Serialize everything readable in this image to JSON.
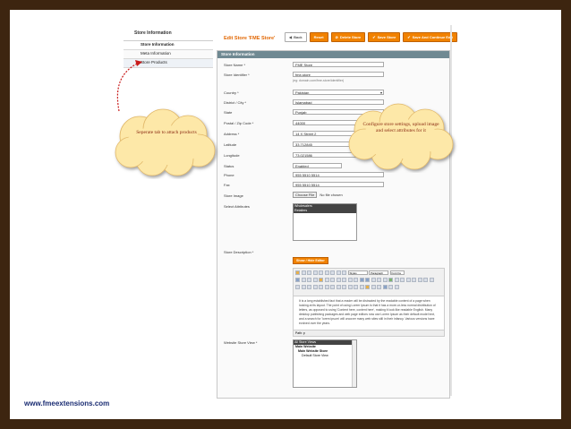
{
  "footer": {
    "url": "www.fmeextensions.com"
  },
  "sidebar": {
    "header": "Store Information",
    "items": [
      {
        "label": "Store Information"
      },
      {
        "label": "Meta Information"
      },
      {
        "label": "Store Products"
      }
    ]
  },
  "header": {
    "title": "Edit Store 'FME Store'",
    "buttons": {
      "back": "Back",
      "reset": "Reset",
      "delete": "Delete Store",
      "save": "Save Store",
      "save_continue": "Save And Continue Edit"
    }
  },
  "panel": {
    "title": "Store Information",
    "fields": {
      "store_name": {
        "label": "Store Name *",
        "value": "FME Store"
      },
      "store_identifier": {
        "label": "Store Identifier *",
        "value": "fme-store",
        "hint": "(eg: domain.com/fme-store/identifier)"
      },
      "country": {
        "label": "Country *",
        "value": "Pakistan"
      },
      "district_city": {
        "label": "District / City *",
        "value": "Islamabad"
      },
      "state": {
        "label": "State",
        "value": "Punjab"
      },
      "postal_zip": {
        "label": "Postal / Zip Code *",
        "value": "44000"
      },
      "address": {
        "label": "Address *",
        "value": "14 X Street 2"
      },
      "latitude": {
        "label": "Latitude",
        "value": "33.712845"
      },
      "longitude": {
        "label": "Longitude",
        "value": "73.021586"
      },
      "status": {
        "label": "Status",
        "value": "Enabled"
      },
      "phone": {
        "label": "Phone",
        "value": "955 5510 5514"
      },
      "fax": {
        "label": "Fax",
        "value": "955 5510 5514"
      },
      "store_image": {
        "label": "Store Image",
        "button": "Choose File",
        "value": "No file chosen"
      },
      "select_attributes": {
        "label": "Select Attributes",
        "options": [
          "Wholesalers",
          "Retailers"
        ]
      },
      "store_description": {
        "label": "Store Description *",
        "editor_button": "Show / Hide Editor",
        "styles_select": "Styles",
        "format_select": "Paragraph",
        "font_select": "Font Fa",
        "text": "It is a long established fact that a reader will be distracted by the readable content of a page when looking at its layout. The point of using Lorem Ipsum is that it has a more-or-less normal distribution of letters, as opposed to using 'Content here, content here', making it look like readable English. Many desktop publishing packages and web page editors now use Lorem Ipsum as their default model text, and a search for 'lorem ipsum' will uncover many web sites still in their infancy. Various versions have evolved over the years.",
        "path": "Path: p"
      },
      "website_store_view": {
        "label": "Website Store View *",
        "options": [
          "All Store Views",
          "Main Website",
          "Main Website Store",
          "Default Store View"
        ]
      }
    }
  },
  "callouts": {
    "left": "Seperate tab to attach products",
    "right": "Configure store settings, upload image and select attributes for it"
  },
  "colors": {
    "frame": "#3d2510",
    "accent": "#f18200",
    "panel_head": "#6f8992",
    "callout_fill": "#fde8a8",
    "callout_text": "#8a2a12"
  }
}
